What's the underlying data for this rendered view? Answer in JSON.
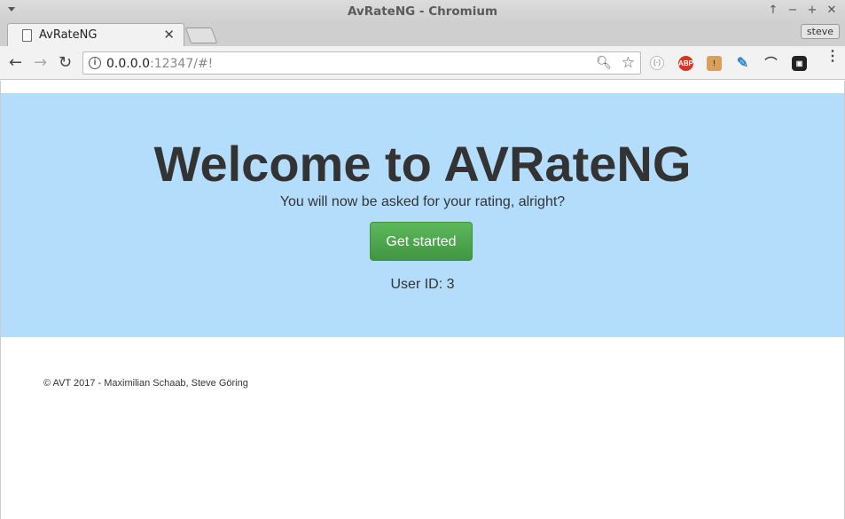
{
  "window": {
    "title": "AvRateNG - Chromium",
    "controls": [
      "↑",
      "−",
      "+",
      "✕"
    ]
  },
  "tabs": [
    {
      "label": "AvRateNG",
      "close": "✕"
    }
  ],
  "profile": "steve",
  "toolbar": {
    "back": "←",
    "forward": "→",
    "reload": "↻",
    "url_host": "0.0.0.0",
    "url_path": ":12347/#!",
    "zoom_icon": "zoom-icon",
    "star_icon": "star-icon",
    "extensions": [
      {
        "name": "extension-circle-icon",
        "text": "(·)"
      },
      {
        "name": "adblock-plus-icon",
        "text": "ABP"
      },
      {
        "name": "extension-box-icon",
        "text": "!"
      },
      {
        "name": "extension-feather-icon",
        "text": "✎"
      },
      {
        "name": "extension-bird-icon",
        "text": "⌒"
      },
      {
        "name": "extension-dark-icon",
        "text": "▣"
      }
    ],
    "menu": "⋮"
  },
  "page": {
    "heading": "Welcome to AVRateNG",
    "lead": "You will now be asked for your rating, alright?",
    "button": "Get started",
    "user_id": "User ID: 3",
    "footer": "© AVT 2017 - Maximilian Schaab, Steve Göring"
  },
  "colors": {
    "jumbotron": "#b4ddfc",
    "button": "#4cae4c"
  }
}
